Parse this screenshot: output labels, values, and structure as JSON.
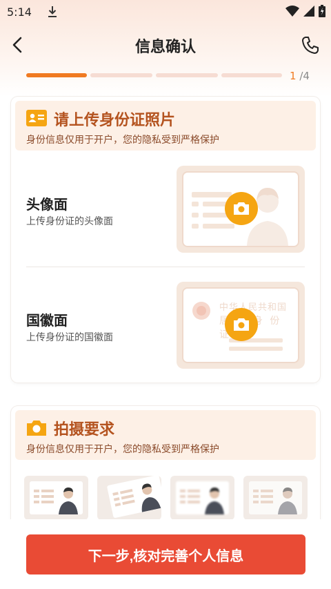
{
  "status_bar": {
    "time": "5:14",
    "icons": [
      "download-icon",
      "wifi-icon",
      "signal-icon",
      "battery-icon"
    ]
  },
  "header": {
    "title": "信息确认",
    "back_icon": "chevron-left-icon",
    "phone_icon": "phone-icon"
  },
  "progress": {
    "current": "1",
    "total": " /4",
    "steps": 4,
    "active_steps": 1
  },
  "upload_section": {
    "icon": "id-card-icon",
    "title": "请上传身份证照片",
    "subtitle": "身份信息仅用于开户，您的隐私受到严格保护",
    "front": {
      "title": "头像面",
      "subtitle": "上传身份证的头像面"
    },
    "back": {
      "title": "国徽面",
      "subtitle": "上传身份证的国徽面",
      "card_text_line1": "中华人民共和国",
      "card_text_line2": "居 民 身 份 证"
    }
  },
  "requirements_section": {
    "icon": "camera-icon",
    "title": "拍摄要求",
    "subtitle": "身份信息仅用于开户，您的隐私受到严格保护"
  },
  "footer": {
    "next_label": "下一步,核对完善个人信息"
  },
  "colors": {
    "accent": "#f07a22",
    "button": "#e94b35",
    "title_brown": "#b4531f",
    "camera_yellow": "#f5a512"
  }
}
